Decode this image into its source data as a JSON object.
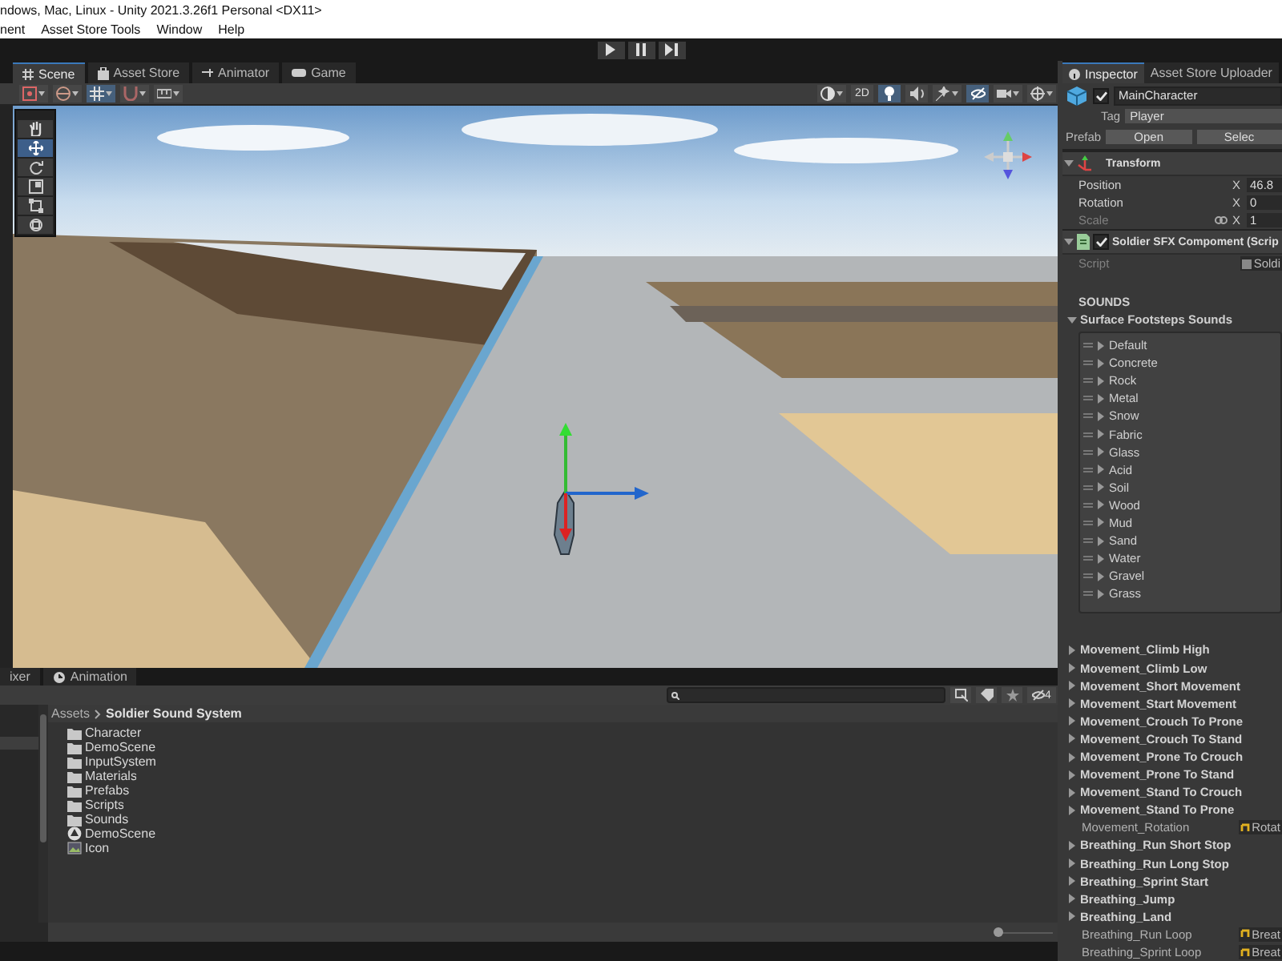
{
  "window": {
    "title": "ndows, Mac, Linux - Unity 2021.3.26f1 Personal <DX11>"
  },
  "menu": [
    "nent",
    "Asset Store Tools",
    "Window",
    "Help"
  ],
  "play_controls": [
    {
      "kind": "play",
      "on": false
    },
    {
      "kind": "pause",
      "on": false
    },
    {
      "kind": "step",
      "on": false
    }
  ],
  "scene_tabs": [
    {
      "label": "Scene",
      "kind": "scene",
      "selected": true
    },
    {
      "label": "Asset Store",
      "kind": "store",
      "selected": false
    },
    {
      "label": "Animator",
      "kind": "animator",
      "selected": false
    },
    {
      "label": "Game",
      "kind": "game",
      "selected": false
    }
  ],
  "scene_toolbar": {
    "left": [
      {
        "kind": "pivot",
        "on": false
      },
      {
        "kind": "global",
        "on": false
      },
      {
        "kind": "grid",
        "on": true
      },
      {
        "kind": "snap",
        "on": false
      },
      {
        "kind": "increment",
        "on": false
      }
    ],
    "right": [
      {
        "kind": "shading",
        "on": false
      },
      {
        "kind": "text",
        "label": "2D",
        "on": false
      },
      {
        "kind": "light",
        "on": true
      },
      {
        "kind": "audio",
        "on": false
      },
      {
        "kind": "effects",
        "on": false
      },
      {
        "kind": "visibility",
        "on": true
      },
      {
        "kind": "camera",
        "on": false
      },
      {
        "kind": "gizmos",
        "on": false
      }
    ]
  },
  "scene_tools": [
    {
      "kind": "hand",
      "selected": false
    },
    {
      "kind": "move",
      "selected": true
    },
    {
      "kind": "rotate",
      "selected": false
    },
    {
      "kind": "scale",
      "selected": false
    },
    {
      "kind": "rect",
      "selected": false
    },
    {
      "kind": "transform",
      "selected": false
    }
  ],
  "project": {
    "tabs": [
      {
        "label": "ixer",
        "kind": "mixer",
        "selected": false
      },
      {
        "label": "Animation",
        "kind": "animation",
        "selected": false
      }
    ],
    "hidden_count": "4",
    "breadcrumb": [
      "Assets",
      "Soldier Sound System"
    ],
    "items": [
      {
        "name": "Character",
        "kind": "folder"
      },
      {
        "name": "DemoScene",
        "kind": "folder"
      },
      {
        "name": "InputSystem",
        "kind": "folder"
      },
      {
        "name": "Materials",
        "kind": "folder"
      },
      {
        "name": "Prefabs",
        "kind": "folder"
      },
      {
        "name": "Scripts",
        "kind": "folder"
      },
      {
        "name": "Sounds",
        "kind": "folder"
      },
      {
        "name": "DemoScene",
        "kind": "scene"
      },
      {
        "name": "Icon",
        "kind": "image"
      }
    ],
    "zoom_slider": {
      "level": 0
    }
  },
  "inspector": {
    "tabs": [
      {
        "label": "Inspector",
        "kind": "info",
        "selected": true
      },
      {
        "label": "Asset Store Uploader",
        "kind": "plain",
        "selected": false
      }
    ],
    "object": {
      "active": true,
      "name": "MainCharacter",
      "tag_label": "Tag",
      "tag": "Player",
      "prefab_label": "Prefab",
      "prefab_buttons": [
        "Open",
        "Selec"
      ]
    },
    "transform": {
      "title": "Transform",
      "expanded": true,
      "rows": [
        {
          "label": "Position",
          "axis": "X",
          "value": "46.8",
          "linked": false
        },
        {
          "label": "Rotation",
          "axis": "X",
          "value": "0",
          "linked": false
        },
        {
          "label": "Scale",
          "axis": "X",
          "value": "1",
          "linked": true
        }
      ]
    },
    "component": {
      "title": "Soldier SFX Compoment (Scrip",
      "expanded": true,
      "enabled": true,
      "script_label": "Script",
      "script_value": "Soldi",
      "section": "SOUNDS",
      "list": {
        "title": "Surface Footsteps Sounds",
        "expanded": true,
        "items": [
          {
            "label": "Default",
            "expanded": false
          },
          {
            "label": "Concrete",
            "expanded": false
          },
          {
            "label": "Rock",
            "expanded": false
          },
          {
            "label": "Metal",
            "expanded": false
          },
          {
            "label": "Snow",
            "expanded": false
          },
          {
            "label": "Fabric",
            "expanded": false
          },
          {
            "label": "Glass",
            "expanded": false
          },
          {
            "label": "Acid",
            "expanded": false
          },
          {
            "label": "Soil",
            "expanded": false
          },
          {
            "label": "Wood",
            "expanded": false
          },
          {
            "label": "Mud",
            "expanded": false
          },
          {
            "label": "Sand",
            "expanded": false
          },
          {
            "label": "Water",
            "expanded": false
          },
          {
            "label": "Gravel",
            "expanded": false
          },
          {
            "label": "Grass",
            "expanded": false
          }
        ]
      },
      "properties": [
        {
          "kind": "group",
          "label": "Movement_Climb High",
          "expanded": false
        },
        {
          "kind": "group",
          "label": "Movement_Climb Low",
          "expanded": false
        },
        {
          "kind": "group",
          "label": "Movement_Short Movement",
          "expanded": false
        },
        {
          "kind": "group",
          "label": "Movement_Start Movement",
          "expanded": false
        },
        {
          "kind": "group",
          "label": "Movement_Crouch To Prone",
          "expanded": false
        },
        {
          "kind": "group",
          "label": "Movement_Crouch To Stand",
          "expanded": false
        },
        {
          "kind": "group",
          "label": "Movement_Prone To Crouch",
          "expanded": false
        },
        {
          "kind": "group",
          "label": "Movement_Prone To Stand",
          "expanded": false
        },
        {
          "kind": "group",
          "label": "Movement_Stand To Crouch",
          "expanded": false
        },
        {
          "kind": "group",
          "label": "Movement_Stand To Prone",
          "expanded": false
        },
        {
          "kind": "field",
          "label": "Movement_Rotation",
          "value": "Rotat"
        },
        {
          "kind": "group",
          "label": "Breathing_Run Short Stop",
          "expanded": false
        },
        {
          "kind": "group",
          "label": "Breathing_Run Long Stop",
          "expanded": false
        },
        {
          "kind": "group",
          "label": "Breathing_Sprint Start",
          "expanded": false
        },
        {
          "kind": "group",
          "label": "Breathing_Jump",
          "expanded": false
        },
        {
          "kind": "group",
          "label": "Breathing_Land",
          "expanded": false
        },
        {
          "kind": "field",
          "label": "Breathing_Run Loop",
          "value": "Breat"
        },
        {
          "kind": "field",
          "label": "Breathing_Sprint Loop",
          "value": "Breat"
        }
      ]
    }
  }
}
